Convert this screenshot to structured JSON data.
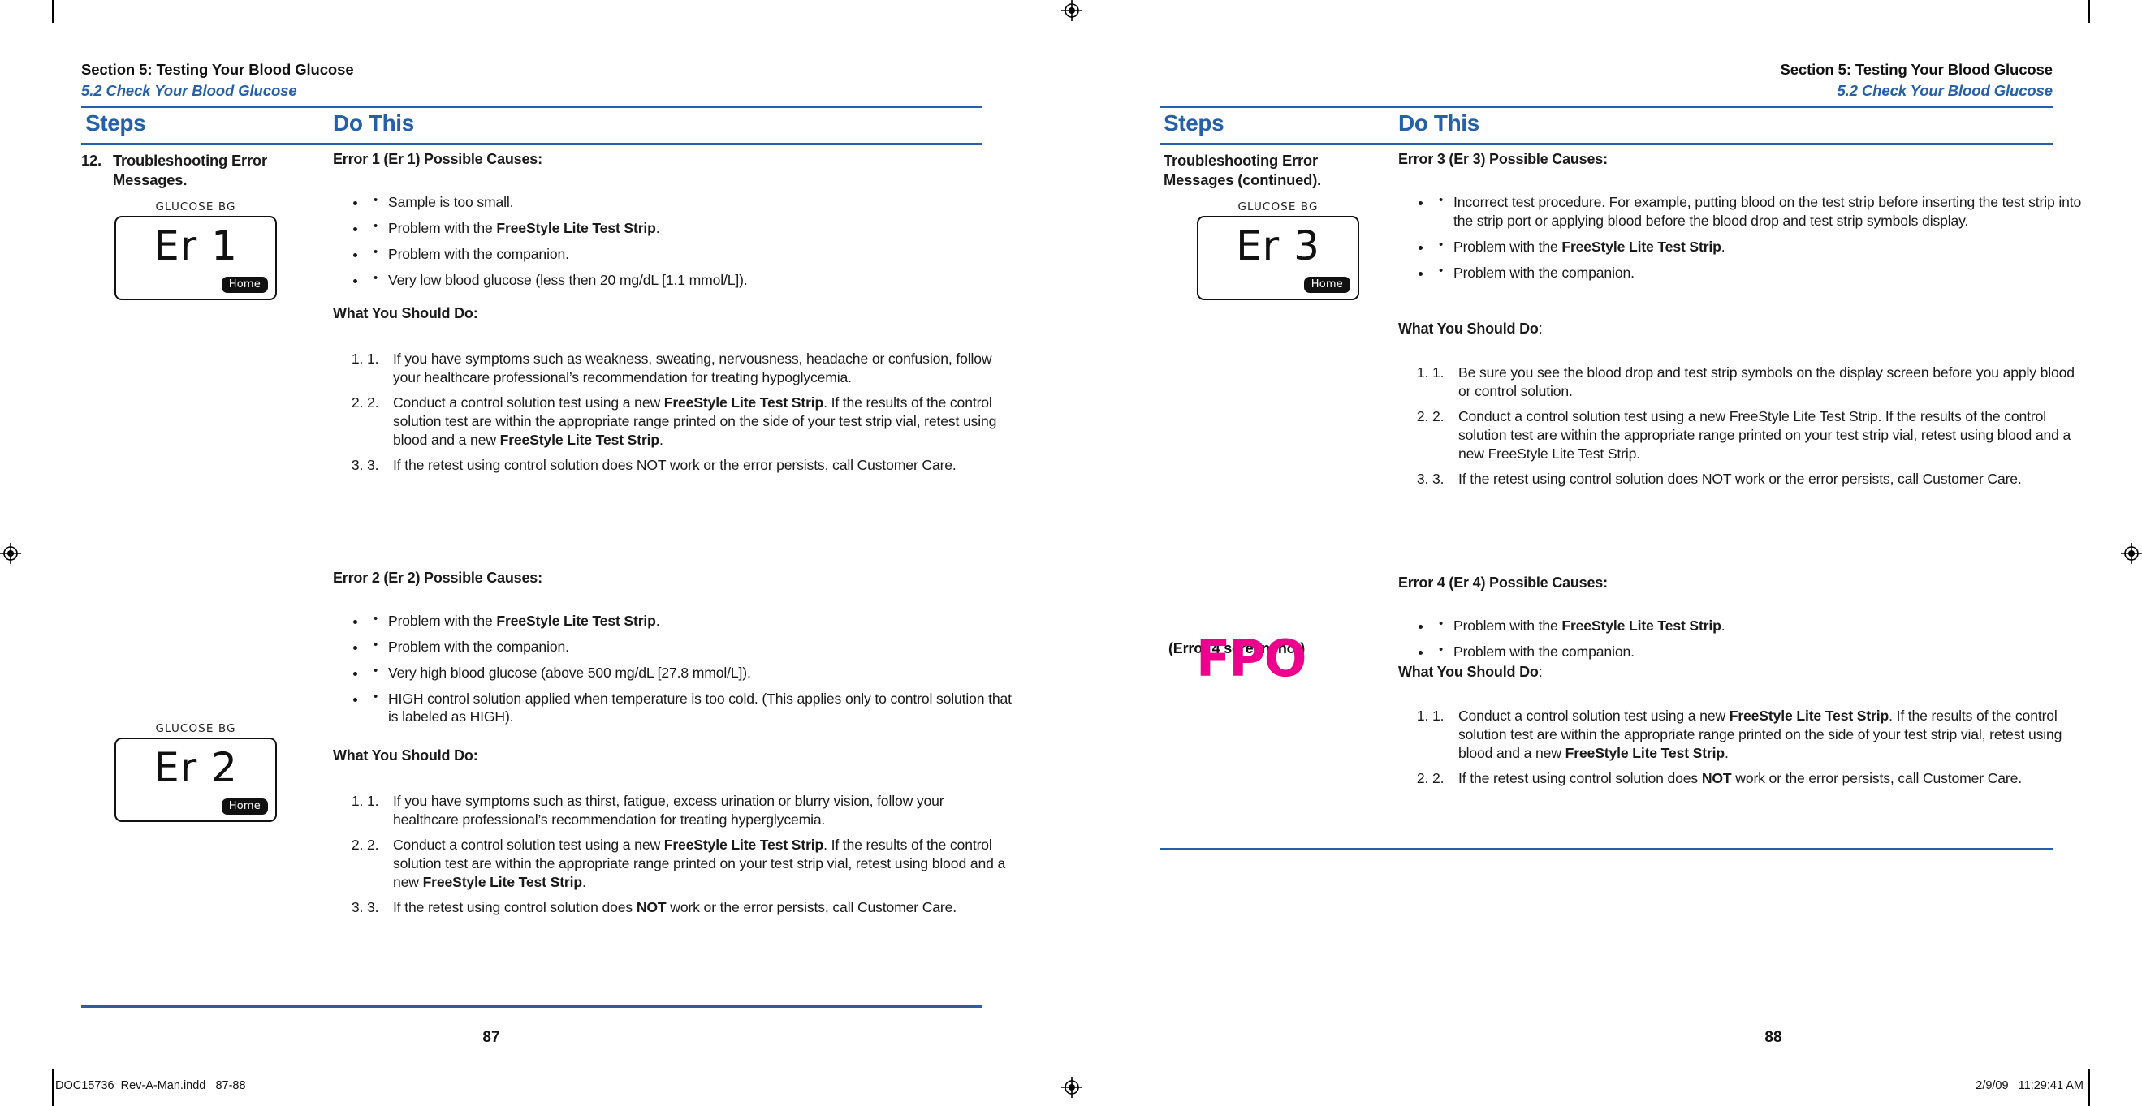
{
  "document": {
    "imprint_left": "DOC15736_Rev-A-Man.indd   87-88",
    "imprint_right": "2/9/09   11:29:41 AM"
  },
  "colors": {
    "accent_blue": "#2560a8",
    "fpo_magenta": "#ec008c",
    "text": "#1a1a1a"
  },
  "left_page": {
    "folio": "87",
    "running_head": {
      "section": "Section 5: Testing Your Blood Glucose",
      "subsection": "5.2 Check Your Blood Glucose"
    },
    "columns": {
      "steps": "Steps",
      "do_this": "Do This"
    },
    "step": {
      "number": "12.",
      "label": "Troubleshooting Error Messages."
    },
    "meter_er1": {
      "label": "GLUCOSE BG",
      "value": "Er 1",
      "button": "Home"
    },
    "meter_er2": {
      "label": "GLUCOSE BG",
      "value": "Er 2",
      "button": "Home"
    },
    "error1": {
      "heading": "Error 1 (Er 1) Possible Causes:",
      "causes": [
        {
          "pre": "Sample is too small.",
          "bold": "",
          "post": ""
        },
        {
          "pre": "Problem with the ",
          "bold": "FreeStyle Lite Test Strip",
          "post": "."
        },
        {
          "pre": "Problem with the companion.",
          "bold": "",
          "post": ""
        },
        {
          "pre": "Very low blood glucose (less then 20 mg/dL [1.1 mmol/L]).",
          "bold": "",
          "post": ""
        }
      ],
      "what_heading": "What You Should Do:",
      "what_heading_colon": "",
      "actions": [
        {
          "n": "1.",
          "pre": "If you have symptoms such as weakness, sweating, nervousness, headache or confusion, follow your healthcare professional’s recommendation for treating hypoglycemia.",
          "b1": "",
          "mid": "",
          "b2": "",
          "post": ""
        },
        {
          "n": "2.",
          "pre": "Conduct a control solution test using a new ",
          "b1": "FreeStyle Lite Test Strip",
          "mid": ". If the results of the control solution test are within the appropriate range printed on the side of your test strip vial, retest using blood and a new ",
          "b2": "FreeStyle Lite Test Strip",
          "post": "."
        },
        {
          "n": "3.",
          "pre": "If the retest using control solution does NOT work or the error persists, call Customer Care.",
          "b1": "",
          "mid": "",
          "b2": "",
          "post": ""
        }
      ]
    },
    "error2": {
      "heading": "Error 2 (Er 2) Possible Causes:",
      "causes": [
        {
          "pre": "Problem with the ",
          "bold": "FreeStyle Lite Test Strip",
          "post": "."
        },
        {
          "pre": "Problem with the companion.",
          "bold": "",
          "post": ""
        },
        {
          "pre": "Very high blood glucose (above 500 mg/dL [27.8 mmol/L]).",
          "bold": "",
          "post": ""
        },
        {
          "pre": "HIGH control solution applied when temperature is too cold. (This applies only to control solution that is labeled as HIGH).",
          "bold": "",
          "post": ""
        }
      ],
      "what_heading": "What You Should Do:",
      "actions": [
        {
          "n": "1.",
          "pre": "If you have symptoms such as thirst, fatigue, excess urination or blurry vision, follow your healthcare professional’s recommendation for treating hyperglycemia.",
          "b1": "",
          "mid": "",
          "b2": "",
          "post": ""
        },
        {
          "n": "2.",
          "pre": "Conduct a control solution test using a new ",
          "b1": "FreeStyle Lite Test Strip",
          "mid": ". If the results of the control solution test are within the appropriate range printed on your test strip vial, retest using blood and a new ",
          "b2": "FreeStyle Lite Test Strip",
          "post": "."
        },
        {
          "n": "3.",
          "pre": "If the retest using control solution does ",
          "b1": "NOT",
          "mid": " work or the error persists, call Customer Care.",
          "b2": "",
          "post": ""
        }
      ]
    }
  },
  "right_page": {
    "folio": "88",
    "running_head": {
      "section": "Section 5: Testing Your Blood Glucose",
      "subsection": "5.2 Check Your Blood Glucose"
    },
    "columns": {
      "steps": "Steps",
      "do_this": "Do This"
    },
    "step": {
      "label": "Troubleshooting Error Messages (continued)."
    },
    "meter_er3": {
      "label": "GLUCOSE BG",
      "value": "Er 3",
      "button": "Home"
    },
    "fpo": {
      "caption": "(Error 4 screenshot)",
      "mark": "FPO"
    },
    "error3": {
      "heading": "Error 3 (Er 3) Possible Causes:",
      "causes": [
        {
          "pre": "Incorrect test procedure. For example, putting blood on the test strip before inserting the test strip into the strip port or applying blood before the blood drop and test strip symbols display.",
          "bold": "",
          "post": ""
        },
        {
          "pre": "Problem with the ",
          "bold": "FreeStyle Lite Test Strip",
          "post": "."
        },
        {
          "pre": "Problem with the companion.",
          "bold": "",
          "post": ""
        }
      ],
      "what_heading": "What You Should Do",
      "what_heading_colon": ":",
      "actions": [
        {
          "n": "1.",
          "pre": "Be sure you see the blood drop and test strip symbols on the display screen before you apply blood or control solution.",
          "b1": "",
          "mid": "",
          "b2": "",
          "post": ""
        },
        {
          "n": "2.",
          "pre": "Conduct a control solution test using a new FreeStyle Lite Test Strip. If the results of the control solution test are within the appropriate range printed on your test strip vial, retest using blood and a new FreeStyle Lite Test Strip.",
          "b1": "",
          "mid": "",
          "b2": "",
          "post": ""
        },
        {
          "n": "3.",
          "pre": "If the retest using control solution does NOT work or the error persists, call Customer Care.",
          "b1": "",
          "mid": "",
          "b2": "",
          "post": ""
        }
      ]
    },
    "error4": {
      "heading": "Error 4 (Er 4) Possible Causes:",
      "causes": [
        {
          "pre": "Problem with the ",
          "bold": "FreeStyle Lite Test Strip",
          "post": "."
        },
        {
          "pre": "Problem with the companion.",
          "bold": "",
          "post": ""
        }
      ],
      "what_heading": "What You Should Do",
      "what_heading_colon": ":",
      "actions": [
        {
          "n": "1.",
          "pre": "Conduct a control solution test using a new ",
          "b1": "FreeStyle Lite Test Strip",
          "mid": ". If the results of the control solution test are within the appropriate range printed on the side of your test strip vial, retest using blood and a new ",
          "b2": "FreeStyle Lite Test Strip",
          "post": "."
        },
        {
          "n": "2.",
          "pre": "If the retest using control solution does ",
          "b1": "NOT",
          "mid": " work or the error persists, call Customer Care.",
          "b2": "",
          "post": ""
        }
      ]
    }
  }
}
